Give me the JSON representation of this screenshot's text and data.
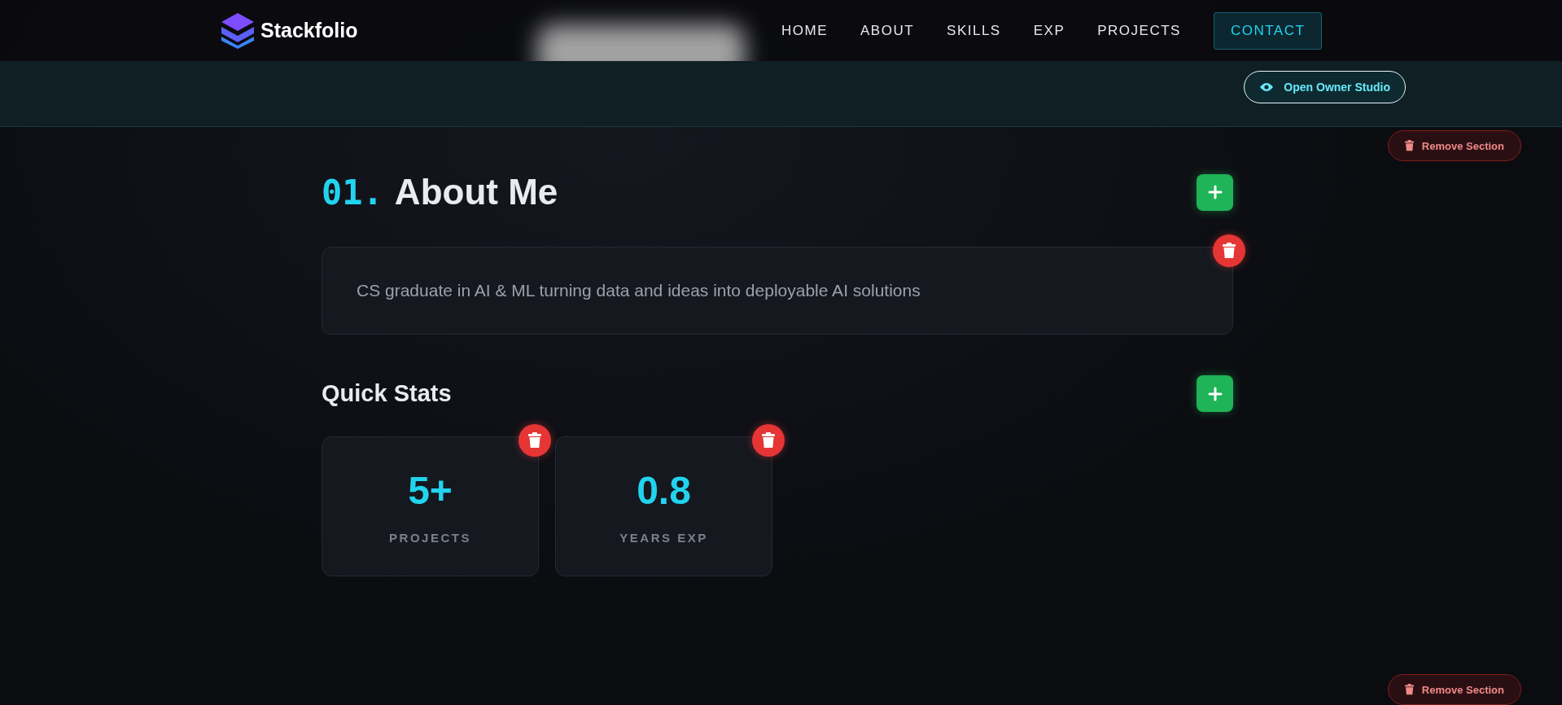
{
  "brand": {
    "name": "Stackfolio"
  },
  "nav": [
    {
      "label": "HOME",
      "kind": "link"
    },
    {
      "label": "ABOUT",
      "kind": "link"
    },
    {
      "label": "SKILLS",
      "kind": "link"
    },
    {
      "label": "EXP",
      "kind": "link"
    },
    {
      "label": "PROJECTS",
      "kind": "link"
    },
    {
      "label": "CONTACT",
      "kind": "button"
    }
  ],
  "owner_button": {
    "label": "Open Owner Studio"
  },
  "remove_section_buttons": [
    "Remove Section",
    "Remove Section"
  ],
  "about": {
    "number": "01.",
    "title": "About Me",
    "text": "CS graduate in AI & ML turning data and ideas into deployable AI solutions"
  },
  "quick_stats": {
    "title": "Quick Stats",
    "stats": [
      {
        "value": "5+",
        "label": "PROJECTS"
      },
      {
        "value": "0.8",
        "label": "YEARS EXP"
      }
    ]
  }
}
